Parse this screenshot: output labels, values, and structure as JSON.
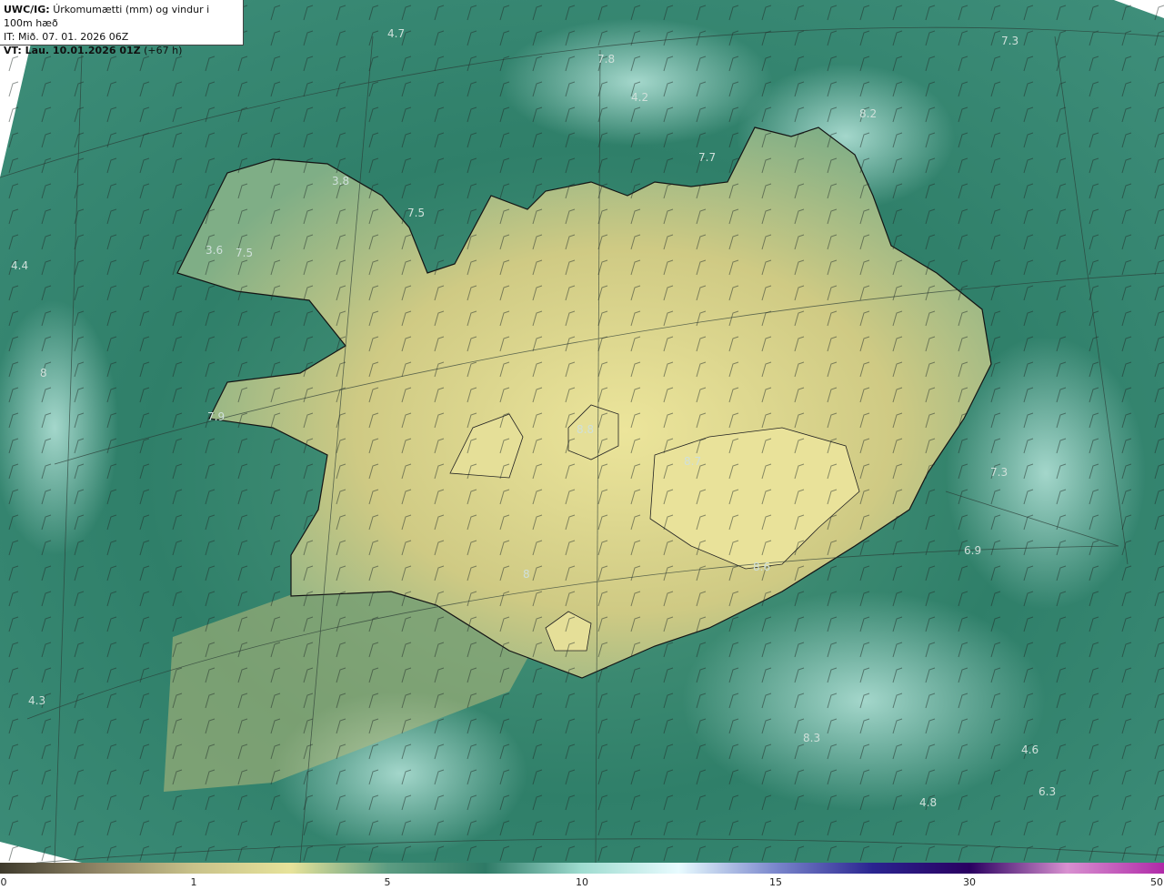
{
  "header": {
    "title_bold": "UWC/IG:",
    "title_text": "Úrkomumætti (mm) og vindur i 100m hæð",
    "init_time": "IT: Mið. 07. 01. 2026 06Z",
    "valid_bold": "VT: Lau. 10.01.2026 01Z",
    "valid_offset": "(+67 h)"
  },
  "map_labels": [
    "4.7",
    "7.8",
    "4.2",
    "7.3",
    "8.2",
    "7.7",
    "3.8",
    "7.5",
    "3.6",
    "7.5",
    "4.4",
    "8",
    "7.9",
    "8.8",
    "8.7",
    "7.3",
    "6.9",
    "8",
    "8.6",
    "4.3",
    "8.3",
    "4.6",
    "6.3",
    "4.8"
  ],
  "colorbar": {
    "ticks": [
      "0",
      "1",
      "5",
      "10",
      "15",
      "30",
      "50"
    ],
    "colors": [
      "#3e3a2c",
      "#8f8465",
      "#c9c28a",
      "#e7e39a",
      "#5c9c82",
      "#2e7a66",
      "#9fdcd0",
      "#e8fbff",
      "#7a86cc",
      "#2a2490",
      "#2a0060",
      "#d890d0",
      "#b02aa8"
    ]
  },
  "palette": {
    "sea_dark": "#24695a",
    "sea_mid": "#3a8a74",
    "land_warm": "#e2dc95",
    "coast": "#141414"
  }
}
